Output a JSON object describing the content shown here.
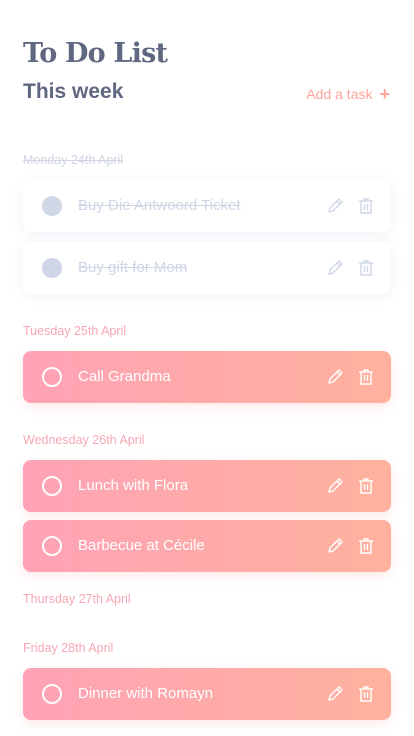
{
  "header": {
    "title": "To Do List",
    "subtitle": "This week",
    "add_task_label": "Add a task",
    "add_task_icon": "plus-icon"
  },
  "colors": {
    "title": "#5f6880",
    "accent": "#ffa599",
    "day_label": "#f7a7b4",
    "task_gradient_start": "#ffa3b6",
    "task_gradient_end": "#ffb19d",
    "completed": "#cfd6e6"
  },
  "days": [
    {
      "label": "Monday 24th April",
      "completed": true,
      "tasks": [
        {
          "label": "Buy Die Antwoord Ticket",
          "done": true
        },
        {
          "label": "Buy gift for Mom",
          "done": true
        }
      ]
    },
    {
      "label": "Tuesday 25th April",
      "completed": false,
      "tasks": [
        {
          "label": "Call Grandma",
          "done": false
        }
      ]
    },
    {
      "label": "Wednesday 26th April",
      "completed": false,
      "tasks": [
        {
          "label": "Lunch with Flora",
          "done": false
        },
        {
          "label": "Barbecue at Cécile",
          "done": false
        }
      ]
    },
    {
      "label": "Thursday 27th April",
      "completed": false,
      "tasks": []
    },
    {
      "label": "Friday 28th April",
      "completed": false,
      "tasks": [
        {
          "label": "Dinner with Romayn",
          "done": false
        }
      ]
    }
  ]
}
